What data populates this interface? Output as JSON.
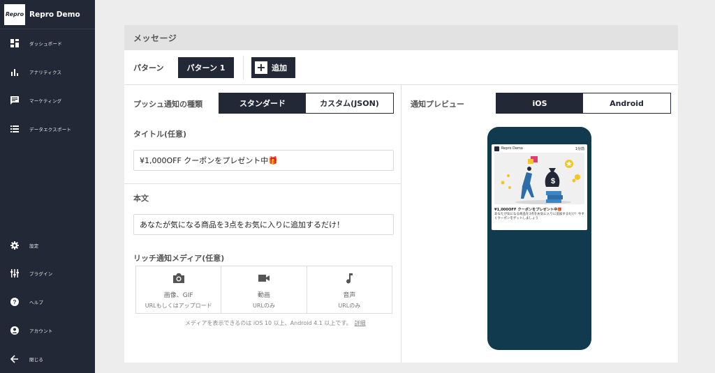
{
  "app": {
    "logo_text": "Repro",
    "name": "Repro Demo"
  },
  "sidebar": {
    "items": [
      {
        "label": "ダッシュボード",
        "icon": "dashboard-icon"
      },
      {
        "label": "アナリティクス",
        "icon": "bar-chart-icon"
      },
      {
        "label": "マーケティング",
        "icon": "message-icon"
      },
      {
        "label": "データエクスポート",
        "icon": "list-icon"
      }
    ],
    "bottom_items": [
      {
        "label": "設定",
        "icon": "gear-icon"
      },
      {
        "label": "プラグイン",
        "icon": "plugin-icon"
      },
      {
        "label": "ヘルプ",
        "icon": "help-icon"
      },
      {
        "label": "アカウント",
        "icon": "account-icon"
      },
      {
        "label": "閉じる",
        "icon": "arrow-left-icon"
      }
    ],
    "bg_color": "#232836"
  },
  "panel": {
    "title": "メッセージ",
    "pattern_label": "パターン",
    "pattern_selected": "パターン 1",
    "add_label": "追加"
  },
  "push_type": {
    "label": "プッシュ通知の種類",
    "options": [
      "スタンダード",
      "カスタム(JSON)"
    ],
    "selected": "スタンダード"
  },
  "title_field": {
    "label": "タイトル(任意)",
    "value": "¥1,000OFF クーポンをプレゼント中🎁"
  },
  "body_field": {
    "label": "本文",
    "value": "あなたが気になる商品を3点をお気に入りに追加するだけ！"
  },
  "rich_media": {
    "label": "リッチ通知メディア(任意)",
    "options": [
      {
        "title": "画像、GIF",
        "sub": "URLもしくはアップロード",
        "icon": "camera-icon"
      },
      {
        "title": "動画",
        "sub": "URLのみ",
        "icon": "video-icon"
      },
      {
        "title": "音声",
        "sub": "URLのみ",
        "icon": "music-note-icon"
      }
    ],
    "note": "メディアを表示できるのは iOS 10 以上、Android 4.1 以上です。",
    "note_link": "詳細"
  },
  "preview": {
    "label": "通知プレビュー",
    "options": [
      "iOS",
      "Android"
    ],
    "selected": "iOS",
    "notification": {
      "app_name": "Repro Demo",
      "time": "1分前",
      "title": "¥1,000OFF クーポンをプレゼント中🎁",
      "body": "あなたが気になる商品を3点をお気に入りに追加するだけ！今すぐクーポンをゲットしましょう"
    }
  },
  "colors": {
    "accent": "#232836",
    "phone": "#123a4e"
  }
}
